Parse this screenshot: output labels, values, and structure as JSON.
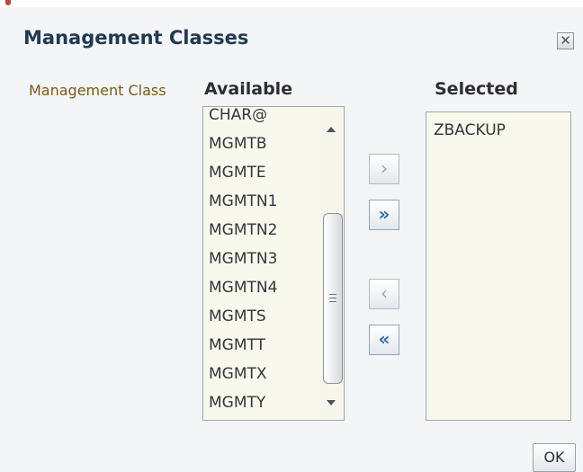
{
  "dialog": {
    "title": "Management Classes",
    "close_label": "✕"
  },
  "field_label": "Management Class",
  "available": {
    "header": "Available",
    "items": [
      "CHAR@",
      "MGMTB",
      "MGMTE",
      "MGMTN1",
      "MGMTN2",
      "MGMTN3",
      "MGMTN4",
      "MGMTS",
      "MGMTT",
      "MGMTX",
      "MGMTY"
    ]
  },
  "selected": {
    "header": "Selected",
    "items": [
      "ZBACKUP"
    ]
  },
  "shuttle": {
    "move_label": "›",
    "move_all_label": "»",
    "remove_label": "‹",
    "remove_all_label": "«"
  },
  "ok_label": "OK",
  "colors": {
    "title": "#1f3a56",
    "field_label": "#7a5a16",
    "list_bg": "#f8f8ec",
    "active_arrow": "#2e6db8",
    "disabled_arrow": "#9ca3ab"
  }
}
